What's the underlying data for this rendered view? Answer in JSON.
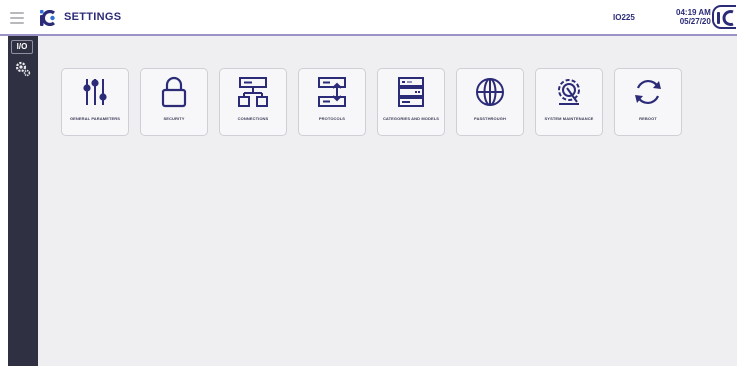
{
  "header": {
    "title": "SETTINGS",
    "device_id": "IO225",
    "time": "04:19 AM",
    "date": "05/27/20"
  },
  "sidebar": {
    "items": [
      {
        "label": "I/O",
        "icon": "io-icon"
      },
      {
        "icon": "gear-icon"
      }
    ]
  },
  "tiles": [
    {
      "label": "GENERAL PARAMETERS",
      "icon": "sliders-icon"
    },
    {
      "label": "SECURITY",
      "icon": "lock-icon"
    },
    {
      "label": "CONNECTIONS",
      "icon": "network-icon"
    },
    {
      "label": "PROTOCOLS",
      "icon": "protocols-icon"
    },
    {
      "label": "CATEGORIES AND MODELS",
      "icon": "server-rack-icon"
    },
    {
      "label": "PASSTHROUGH",
      "icon": "globe-icon"
    },
    {
      "label": "SYSTEM MAINTENANCE",
      "icon": "gear-wrench-icon"
    },
    {
      "label": "REBOOT",
      "icon": "reboot-icon"
    }
  ],
  "colors": {
    "brand": "#2c2b78",
    "sidebar": "#2f3142",
    "content_bg": "#efeff1",
    "accent_blue": "#2f6fd8",
    "header_line": "#9b93c8"
  }
}
